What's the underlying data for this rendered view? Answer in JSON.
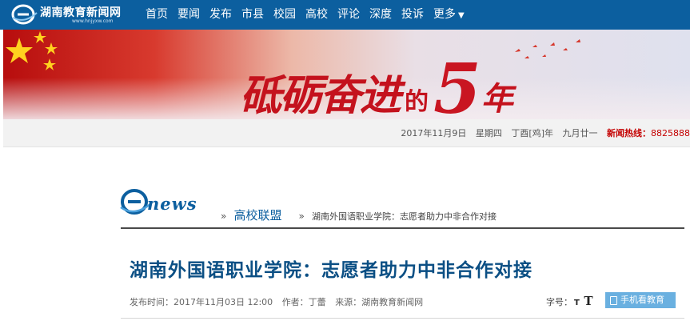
{
  "site": {
    "name": "湖南教育新闻网",
    "url": "www.hnjyxw.com"
  },
  "nav": {
    "items": [
      "首页",
      "要闻",
      "发布",
      "市县",
      "校园",
      "高校",
      "评论",
      "深度",
      "投诉"
    ],
    "more": "更多"
  },
  "banner": {
    "main": "砥砺奋进",
    "de": "的",
    "five": "5",
    "year": "年"
  },
  "datebar": {
    "date": "2017年11月9日",
    "weekday": "星期四",
    "ganzhi": "丁酉[鸡]年",
    "lunar": "九月廿一",
    "hotline_label": "新闻热线：",
    "hotline_number": "8825888"
  },
  "breadcrumb": {
    "logo_text": "news",
    "section": "高校联盟",
    "current": "湖南外国语职业学院：志愿者助力中非合作对接",
    "sep": "»"
  },
  "article": {
    "title": "湖南外国语职业学院：志愿者助力中非合作对接",
    "published": "发布时间：2017年11月03日 12:00",
    "author": "作者：丁蕾",
    "source": "来源：湖南教育新闻网",
    "font_size_label": "字号：",
    "font_small": "T",
    "font_big": "T",
    "mobile_label": "手机看教育"
  },
  "colors": {
    "nav_bg": "#0c5f9f",
    "title": "#0b4f84",
    "hotline": "#c40000",
    "mobile_btn": "#6ab0e0"
  }
}
